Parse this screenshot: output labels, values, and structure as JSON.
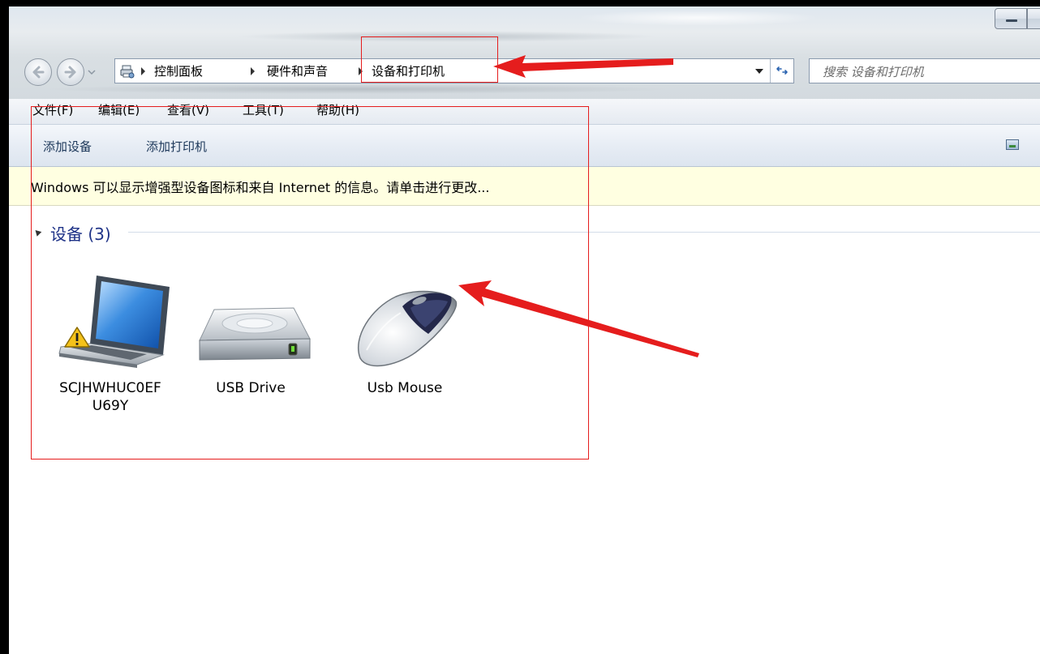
{
  "window": {
    "minimize_label": "minimize-window"
  },
  "navigation": {
    "breadcrumbs": [
      {
        "label": "控制面板"
      },
      {
        "label": "硬件和声音"
      },
      {
        "label": "设备和打印机"
      }
    ],
    "search_placeholder": "搜索 设备和打印机"
  },
  "menu": {
    "items": [
      "文件(F)",
      "编辑(E)",
      "查看(V)",
      "工具(T)",
      "帮助(H)"
    ]
  },
  "toolbar": {
    "add_device": "添加设备",
    "add_printer": "添加打印机"
  },
  "info_bar": {
    "text": "Windows 可以显示增强型设备图标和来自 Internet 的信息。请单击进行更改..."
  },
  "devices_group": {
    "header": "设备 (3)",
    "items": [
      {
        "name": "SCJHWHUC0EF U69Y",
        "line1": "SCJHWHUC0EF",
        "line2": "U69Y",
        "icon": "laptop-icon",
        "warning": true
      },
      {
        "name": "USB Drive",
        "line1": "USB Drive",
        "line2": "",
        "icon": "usb-drive-icon",
        "warning": false
      },
      {
        "name": "Usb Mouse",
        "line1": "Usb Mouse",
        "line2": "",
        "icon": "mouse-icon",
        "warning": false
      }
    ]
  },
  "colors": {
    "annotation_red": "#e51d1d",
    "info_bar_bg": "#ffffe1",
    "group_header": "#1e3287",
    "command_text": "#1e395b"
  }
}
